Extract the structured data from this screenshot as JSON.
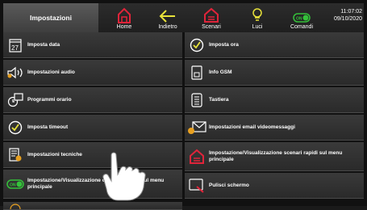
{
  "header": {
    "title": "Impostazioni",
    "nav": [
      {
        "label": "Home",
        "icon": "home-icon"
      },
      {
        "label": "Indietro",
        "icon": "back-arrow-icon"
      },
      {
        "label": "Scenari",
        "icon": "scenes-icon"
      },
      {
        "label": "Luci",
        "icon": "bulb-icon"
      },
      {
        "label": "Comandi",
        "icon": "on-switch-icon"
      }
    ],
    "time": "11:07:02",
    "date": "09/10/2020"
  },
  "colors": {
    "accent_red": "#e0243a",
    "accent_yellow": "#e8e23a",
    "accent_green": "#34c23a"
  },
  "calendar_day": "27",
  "on_label": "ON",
  "menu": {
    "left": [
      {
        "label": "Imposta data",
        "icon": "calendar-icon"
      },
      {
        "label": "Impostazioni audio",
        "icon": "speaker-icon"
      },
      {
        "label": "Programmi orario",
        "icon": "schedule-icon"
      },
      {
        "label": "Imposta timeout",
        "icon": "timeout-check-icon"
      },
      {
        "label": "Impostazioni tecniche",
        "icon": "technical-settings-icon"
      },
      {
        "label": "Impostazione/Visualizzazione comandi rapidi sul menu principale",
        "icon": "on-switch-icon"
      }
    ],
    "right": [
      {
        "label": "Imposta ora",
        "icon": "clock-check-icon"
      },
      {
        "label": "Info GSM",
        "icon": "gsm-icon"
      },
      {
        "label": "Tastiera",
        "icon": "keypad-icon"
      },
      {
        "label": "Impostazioni email videomessaggi",
        "icon": "email-icon"
      },
      {
        "label": "Impostazione/Visualizzazione scenari rapidi sul menu principale",
        "icon": "scenes-icon"
      },
      {
        "label": "Pulisci schermo",
        "icon": "clean-screen-icon"
      }
    ]
  }
}
